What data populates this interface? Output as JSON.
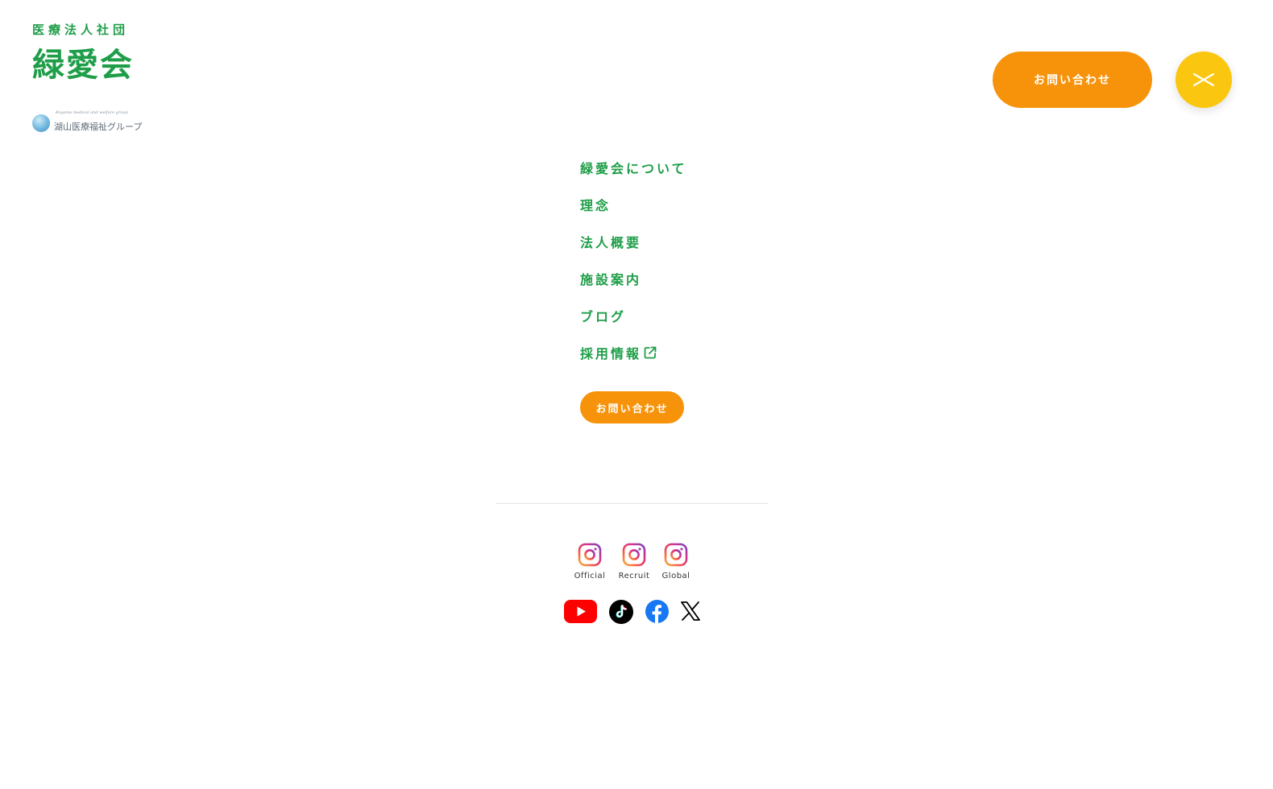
{
  "logo": {
    "subtitle": "医療法人社団",
    "name": "緑愛会",
    "group_tagline": "Koyama medical and welfare group",
    "group_name": "湖山医療福祉グループ"
  },
  "header": {
    "contact_label": "お問い合わせ",
    "close_icon": "close-icon"
  },
  "menu": {
    "items": [
      {
        "label": "緑愛会について"
      },
      {
        "label": "理念"
      },
      {
        "label": "法人概要"
      },
      {
        "label": "施設案内"
      },
      {
        "label": "ブログ"
      },
      {
        "label": "採用情報",
        "icon": "external-link-icon"
      }
    ],
    "contact_label": "お問い合わせ"
  },
  "social": {
    "instagram": [
      {
        "label": "Official",
        "icon": "instagram-icon"
      },
      {
        "label": "Recruit",
        "icon": "instagram-icon"
      },
      {
        "label": "Global",
        "icon": "instagram-icon"
      }
    ],
    "others": [
      {
        "icon": "youtube-icon"
      },
      {
        "icon": "tiktok-icon"
      },
      {
        "icon": "facebook-icon"
      },
      {
        "icon": "x-icon"
      }
    ]
  },
  "colors": {
    "brand_green": "#1e9e48",
    "orange": "#f7930a",
    "yellow": "#fbc60f"
  }
}
